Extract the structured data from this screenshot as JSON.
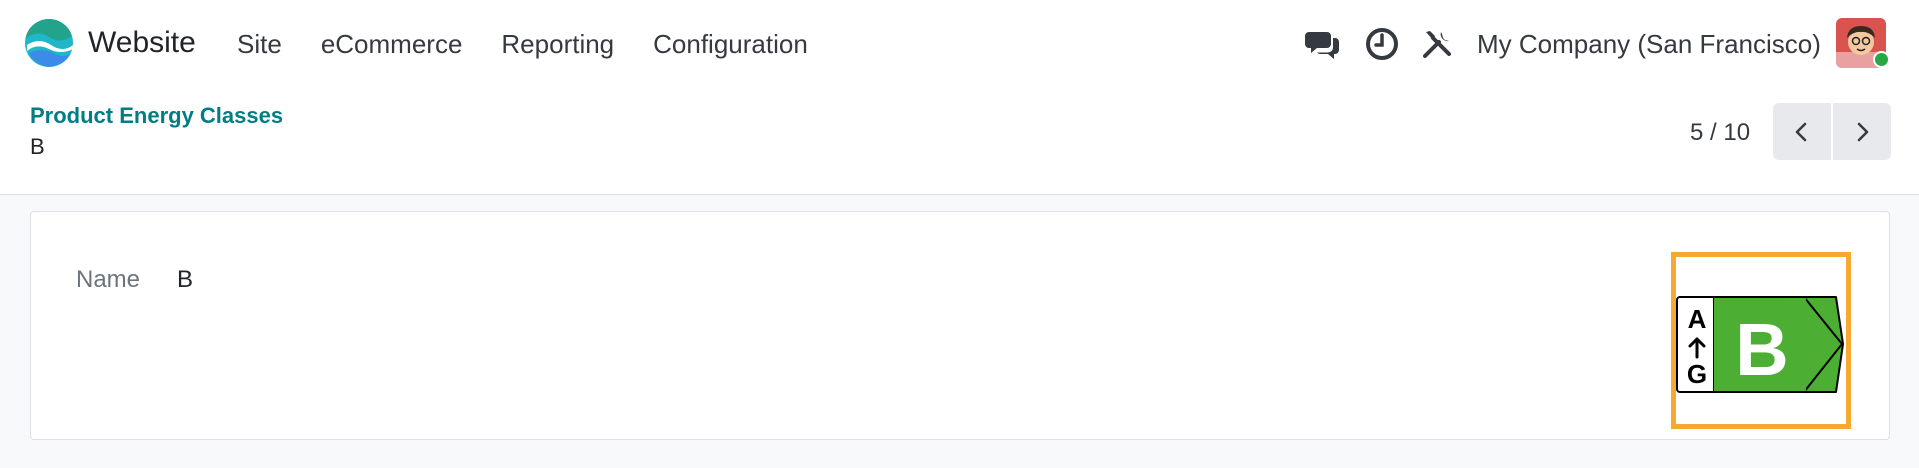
{
  "navbar": {
    "app_name": "Website",
    "menu": [
      {
        "label": "Site"
      },
      {
        "label": "eCommerce"
      },
      {
        "label": "Reporting"
      },
      {
        "label": "Configuration"
      }
    ],
    "icons": [
      "discuss-icon",
      "activity-clock-icon",
      "tools-icon"
    ],
    "company": "My Company (San Francisco)"
  },
  "breadcrumb": {
    "parent": "Product Energy Classes",
    "current": "B"
  },
  "pager": {
    "value": "5 / 10"
  },
  "form": {
    "name_label": "Name",
    "name_value": "B"
  },
  "energy_label": {
    "scale_top": "A",
    "scale_bottom": "G",
    "grade": "B",
    "grade_color": "#4caf33"
  },
  "colors": {
    "accent": "#017e84",
    "highlight_border": "#f7a830",
    "presence": "#28a745"
  }
}
